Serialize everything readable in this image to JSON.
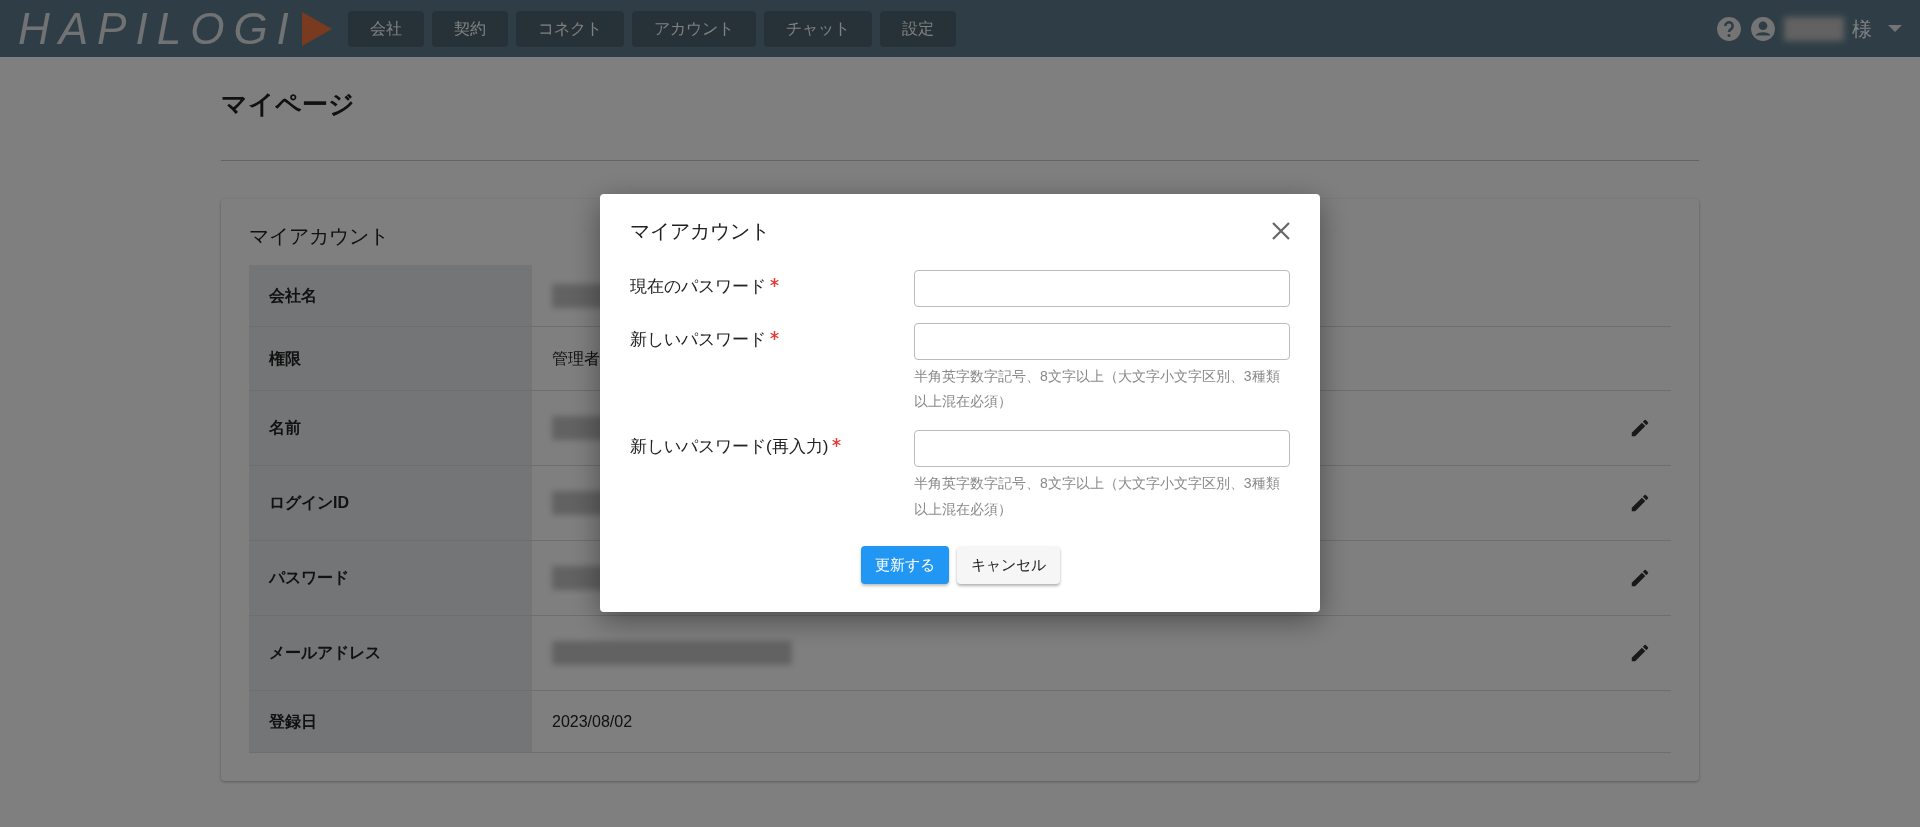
{
  "header": {
    "logo": "HAPILOGI",
    "nav": [
      {
        "label": "会社"
      },
      {
        "label": "契約"
      },
      {
        "label": "コネクト"
      },
      {
        "label": "アカウント"
      },
      {
        "label": "チャット"
      },
      {
        "label": "設定"
      }
    ],
    "user_suffix": "様"
  },
  "page": {
    "title": "マイページ"
  },
  "account_card": {
    "title": "マイアカウント",
    "rows": [
      {
        "label": "会社名",
        "redacted": true,
        "editable": false
      },
      {
        "label": "権限",
        "value": "管理者",
        "redacted": false,
        "editable": false
      },
      {
        "label": "名前",
        "redacted": true,
        "editable": true
      },
      {
        "label": "ログインID",
        "redacted": true,
        "editable": true
      },
      {
        "label": "パスワード",
        "redacted": true,
        "editable": true
      },
      {
        "label": "メールアドレス",
        "redacted": true,
        "editable": true
      },
      {
        "label": "登録日",
        "value": "2023/08/02",
        "redacted": false,
        "editable": false
      }
    ]
  },
  "modal": {
    "title": "マイアカウント",
    "fields": [
      {
        "label": "現在のパスワード",
        "required": true
      },
      {
        "label": "新しいパスワード",
        "required": true,
        "hint": "半角英字数字記号、8文字以上（大文字小文字区別、3種類以上混在必須）"
      },
      {
        "label": "新しいパスワード(再入力)",
        "required": true,
        "hint": "半角英字数字記号、8文字以上（大文字小文字区別、3種類以上混在必須）"
      }
    ],
    "buttons": [
      {
        "label": "更新する",
        "kind": "primary"
      },
      {
        "label": "キャンセル",
        "kind": "secondary"
      }
    ]
  }
}
